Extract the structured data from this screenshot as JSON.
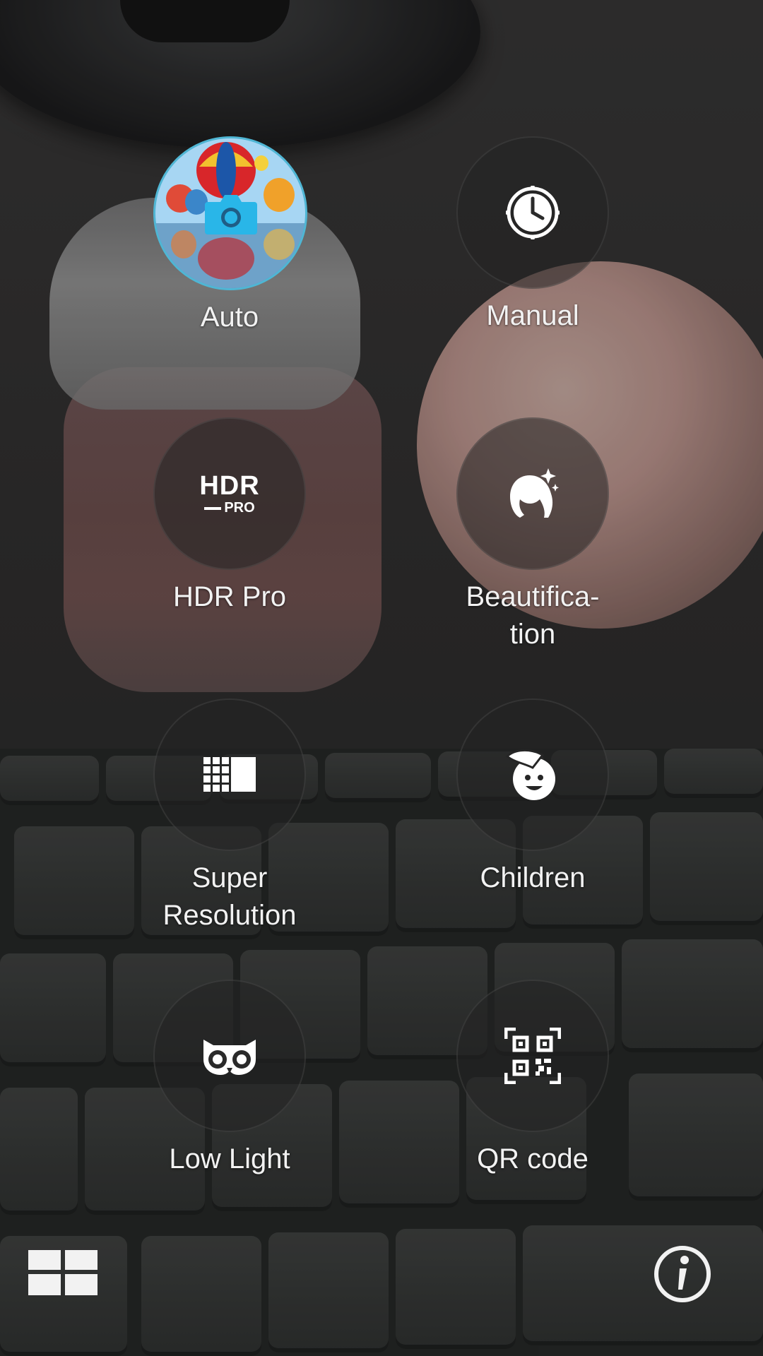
{
  "modes": [
    {
      "label": "Auto",
      "icon": "camera-icon",
      "selected": true
    },
    {
      "label": "Manual",
      "icon": "dial-icon",
      "selected": false
    },
    {
      "label": "HDR Pro",
      "icon": "hdr-pro-icon",
      "icon_text_top": "HDR",
      "icon_text_bottom": "PRO",
      "selected": false
    },
    {
      "label": "Beautifica-\ntion",
      "icon": "beautification-icon",
      "selected": false
    },
    {
      "label": "Super\nResolution",
      "icon": "super-resolution-icon",
      "selected": false
    },
    {
      "label": "Children",
      "icon": "children-icon",
      "selected": false
    },
    {
      "label": "Low Light",
      "icon": "owl-icon",
      "selected": false
    },
    {
      "label": "QR code",
      "icon": "qr-code-icon",
      "selected": false
    }
  ],
  "bottom_bar": {
    "left_icon": "grid-view-icon",
    "right_icon": "info-icon"
  },
  "colors": {
    "accent": "#4fb6d4",
    "camera_icon": "#29b6e8",
    "label_text": "#f2f2f2"
  }
}
